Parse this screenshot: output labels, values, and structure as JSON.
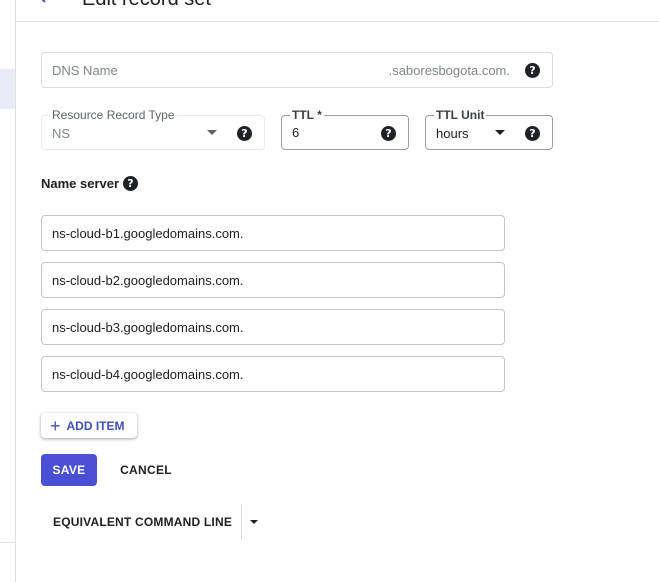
{
  "header": {
    "title": "Edit record set"
  },
  "form": {
    "dns_name": {
      "placeholder": "DNS Name",
      "suffix": ".saboresbogota.com."
    },
    "resource_record_type": {
      "label": "Resource Record Type",
      "value": "NS"
    },
    "ttl": {
      "label": "TTL *",
      "value": "6"
    },
    "ttl_unit": {
      "label": "TTL Unit",
      "value": "hours"
    },
    "name_server": {
      "heading": "Name server",
      "entries": [
        "ns-cloud-b1.googledomains.com.",
        "ns-cloud-b2.googledomains.com.",
        "ns-cloud-b3.googledomains.com.",
        "ns-cloud-b4.googledomains.com."
      ]
    },
    "add_item_label": "ADD ITEM",
    "help_glyph": "?"
  },
  "actions": {
    "save_label": "SAVE",
    "cancel_label": "CANCEL",
    "command_line_label": "EQUIVALENT COMMAND LINE"
  },
  "colors": {
    "primary": "#4a4fd6",
    "accent_text": "#3f51b5"
  }
}
